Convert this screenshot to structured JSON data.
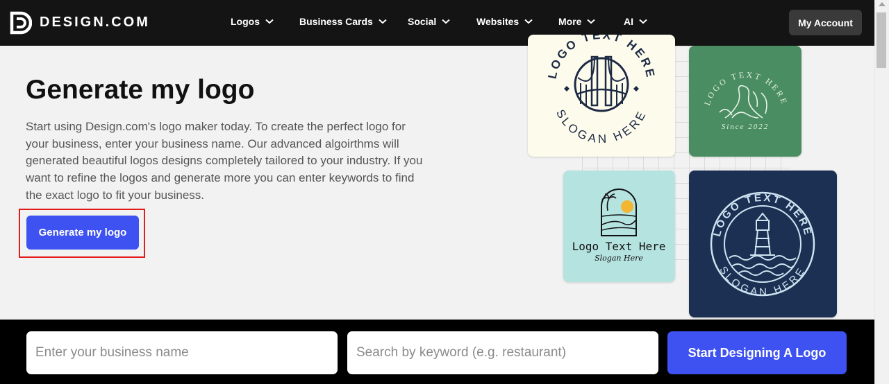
{
  "header": {
    "brand": "DESIGN.COM",
    "nav": [
      {
        "label": "Logos"
      },
      {
        "label": "Business Cards"
      },
      {
        "label": "Social"
      },
      {
        "label": "Websites"
      },
      {
        "label": "More"
      },
      {
        "label": "AI"
      }
    ],
    "account_label": "My Account"
  },
  "hero": {
    "title": "Generate my logo",
    "description": "Start using Design.com's logo maker today. To create the perfect logo for your business, enter your business name. Our advanced algoirthms will generated beautiful logos designs completely tailored to your industry. If you want to refine the logos and generate more you can enter keywords to find the exact logo to fit your business.",
    "button_label": "Generate my logo"
  },
  "samples": {
    "card1": {
      "top_text": "LOGO TEXT HERE",
      "bottom_text": "SLOGAN HERE"
    },
    "card2": {
      "top_text": "LOGO TEXT HERE",
      "since": "Since 2022"
    },
    "card3": {
      "title": "Logo Text Here",
      "slogan": "Slogan Here"
    },
    "card4": {
      "top_text": "LOGO TEXT HERE",
      "bottom_text": "SLOGAN HERE"
    }
  },
  "search": {
    "name_placeholder": "Enter your business name",
    "keyword_placeholder": "Search by keyword (e.g. restaurant)",
    "start_label": "Start Designing A Logo"
  },
  "colors": {
    "accent": "#3d52f0",
    "header_bg": "#141414",
    "highlight": "#e31b1b"
  }
}
